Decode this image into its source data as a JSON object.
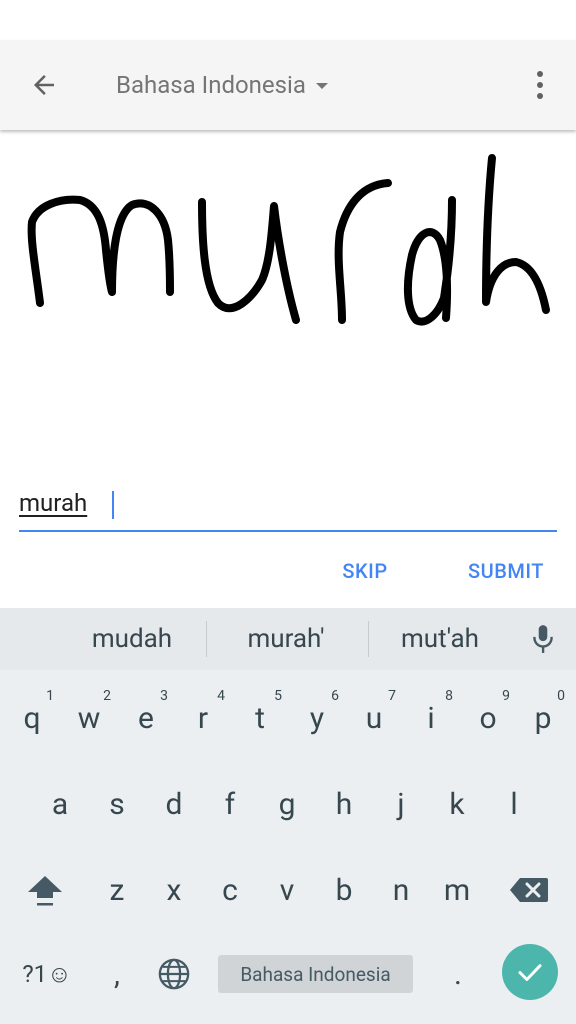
{
  "app_bar": {
    "language": "Bahasa Indonesia"
  },
  "handwriting": {
    "stroke_color": "#000000"
  },
  "input": {
    "value": "murah"
  },
  "actions": {
    "skip_label": "SKIP",
    "submit_label": "SUBMIT"
  },
  "keyboard": {
    "suggestions": [
      "mudah",
      "murah'",
      "mut'ah"
    ],
    "row1": [
      {
        "key": "q",
        "hint": "1"
      },
      {
        "key": "w",
        "hint": "2"
      },
      {
        "key": "e",
        "hint": "3"
      },
      {
        "key": "r",
        "hint": "4"
      },
      {
        "key": "t",
        "hint": "5"
      },
      {
        "key": "y",
        "hint": "6"
      },
      {
        "key": "u",
        "hint": "7"
      },
      {
        "key": "i",
        "hint": "8"
      },
      {
        "key": "o",
        "hint": "9"
      },
      {
        "key": "p",
        "hint": "0"
      }
    ],
    "row2": [
      "a",
      "s",
      "d",
      "f",
      "g",
      "h",
      "j",
      "k",
      "l"
    ],
    "row3": [
      "z",
      "x",
      "c",
      "v",
      "b",
      "n",
      "m"
    ],
    "symbols_label": "?1☺",
    "comma": ",",
    "period": ".",
    "space_label": "Bahasa Indonesia",
    "accent_color": "#4db6ac"
  },
  "colors": {
    "accent": "#4285f4",
    "keyboard_bg": "#eceff1"
  }
}
